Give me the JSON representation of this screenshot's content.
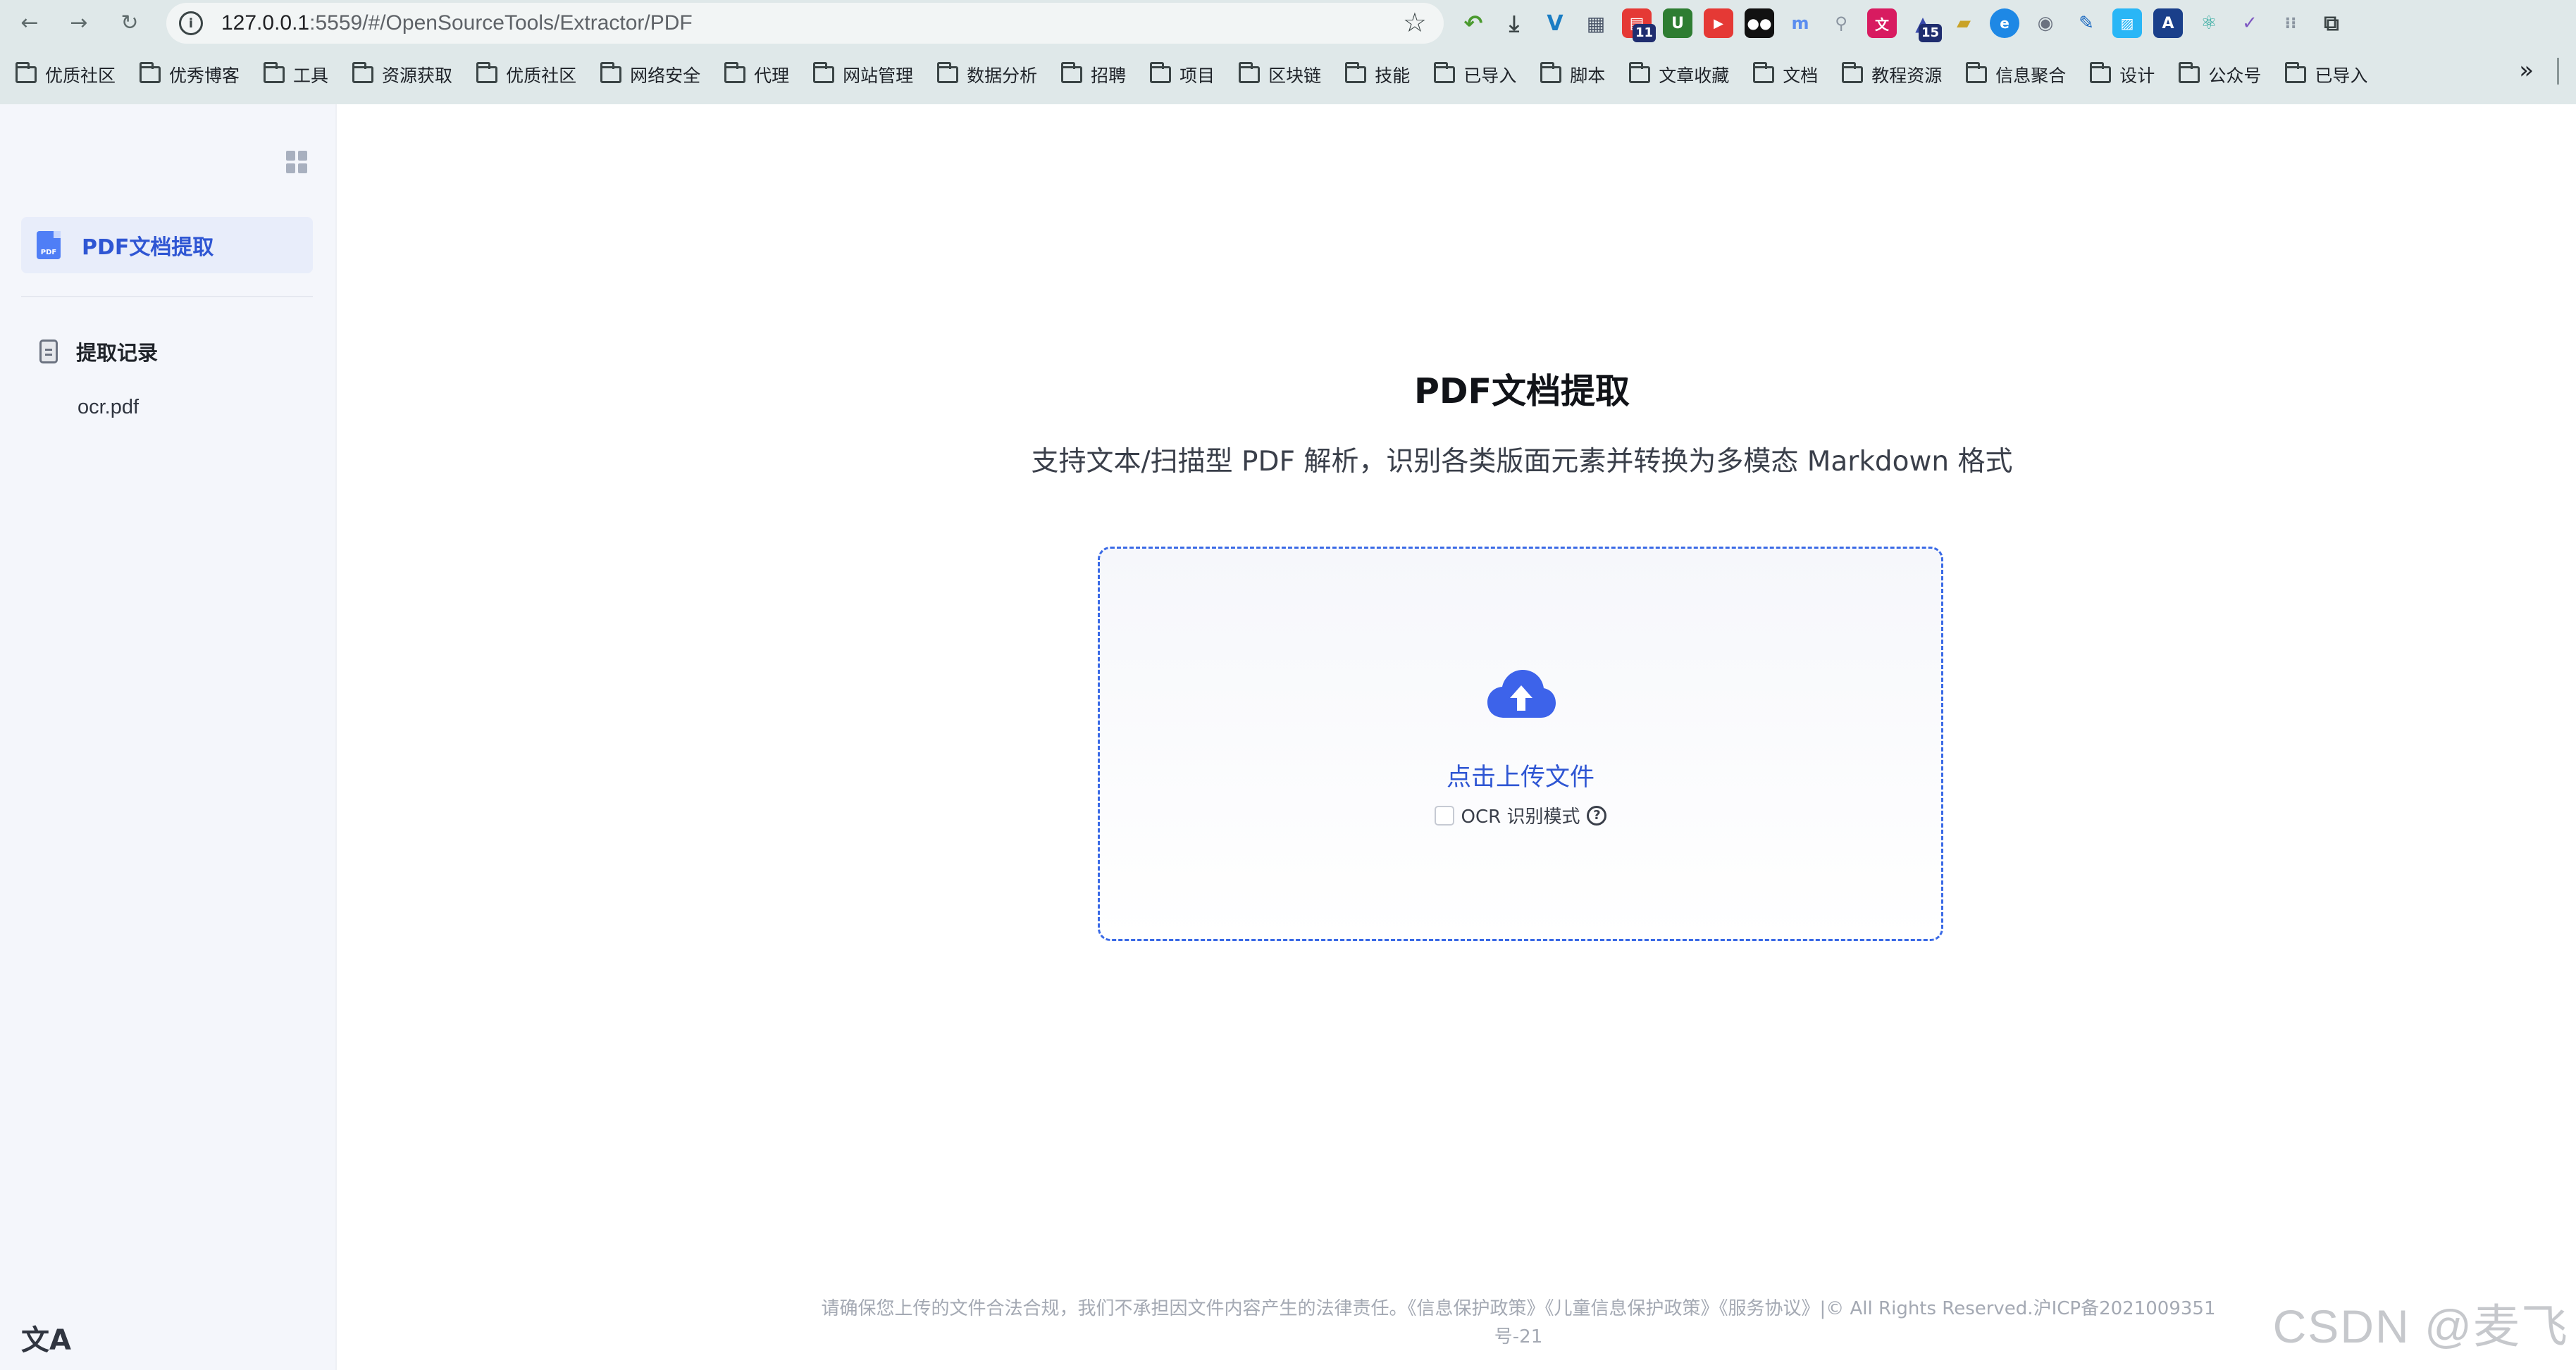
{
  "browser": {
    "url_host": "127.0.0.1",
    "url_path": ":5559/#/OpenSourceTools/Extractor/PDF",
    "extension_badges": {
      "calendar": "11",
      "cap": "15"
    },
    "bookmarks": [
      "优质社区",
      "优秀博客",
      "工具",
      "资源获取",
      "优质社区",
      "网络安全",
      "代理",
      "网站管理",
      "数据分析",
      "招聘",
      "项目",
      "区块链",
      "技能",
      "已导入",
      "脚本",
      "文章收藏",
      "文档",
      "教程资源",
      "信息聚合",
      "设计",
      "公众号",
      "已导入"
    ]
  },
  "sidebar": {
    "active_item": "PDF文档提取",
    "history_title": "提取记录",
    "history_items": [
      "ocr.pdf"
    ]
  },
  "main": {
    "title": "PDF文档提取",
    "subtitle": "支持文本/扫描型 PDF 解析，识别各类版面元素并转换为多模态 Markdown 格式",
    "upload_label": "点击上传文件",
    "ocr_label": "OCR 识别模式"
  },
  "footer": {
    "line1": "请确保您上传的文件合法合规，我们不承担因文件内容产生的法律责任。《信息保护政策》《儿童信息保护政策》《服务协议》|© All Rights Reserved.沪ICP备2021009351",
    "line2": "号-21"
  },
  "watermark": "CSDN @麦飞",
  "colors": {
    "accent": "#2f56d3",
    "cloud": "#3d63ea",
    "sidebar_bg": "#f4f6fb",
    "chrome_bg": "#dfe8e9"
  }
}
